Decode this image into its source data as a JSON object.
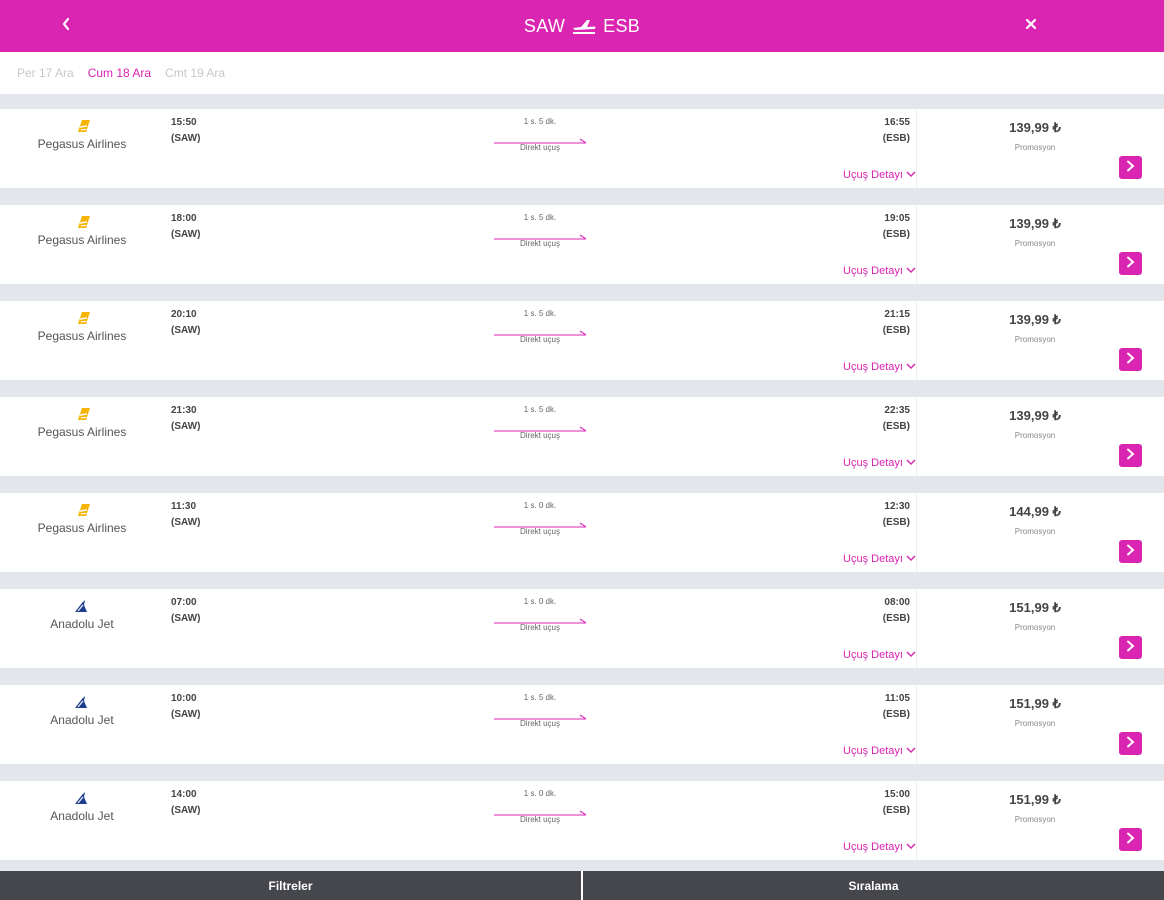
{
  "header": {
    "origin": "SAW",
    "destination": "ESB",
    "back_icon": "chevron-left-icon",
    "close_icon": "close-icon",
    "plane_icon": "plane-icon"
  },
  "date_tabs": [
    {
      "label": "Per 17 Ara",
      "active": false
    },
    {
      "label": "Cum 18 Ara",
      "active": true
    },
    {
      "label": "Cmt 19 Ara",
      "active": false
    }
  ],
  "flights": [
    {
      "airline": "Pegasus Airlines",
      "dep_time": "15:50",
      "dep_code": "(SAW)",
      "duration": "1 s. 5 dk.",
      "type": "Direkt uçuş",
      "arr_time": "16:55",
      "arr_code": "(ESB)",
      "price": "139,99 ₺",
      "fare": "Promosyon",
      "detail": "Uçuş Detayı"
    },
    {
      "airline": "Pegasus Airlines",
      "dep_time": "18:00",
      "dep_code": "(SAW)",
      "duration": "1 s. 5 dk.",
      "type": "Direkt uçuş",
      "arr_time": "19:05",
      "arr_code": "(ESB)",
      "price": "139,99 ₺",
      "fare": "Promosyon",
      "detail": "Uçuş Detayı"
    },
    {
      "airline": "Pegasus Airlines",
      "dep_time": "20:10",
      "dep_code": "(SAW)",
      "duration": "1 s. 5 dk.",
      "type": "Direkt uçuş",
      "arr_time": "21:15",
      "arr_code": "(ESB)",
      "price": "139,99 ₺",
      "fare": "Promosyon",
      "detail": "Uçuş Detayı"
    },
    {
      "airline": "Pegasus Airlines",
      "dep_time": "21:30",
      "dep_code": "(SAW)",
      "duration": "1 s. 5 dk.",
      "type": "Direkt uçuş",
      "arr_time": "22:35",
      "arr_code": "(ESB)",
      "price": "139,99 ₺",
      "fare": "Promosyon",
      "detail": "Uçuş Detayı"
    },
    {
      "airline": "Pegasus Airlines",
      "dep_time": "11:30",
      "dep_code": "(SAW)",
      "duration": "1 s. 0 dk.",
      "type": "Direkt uçuş",
      "arr_time": "12:30",
      "arr_code": "(ESB)",
      "price": "144,99 ₺",
      "fare": "Promosyon",
      "detail": "Uçuş Detayı"
    },
    {
      "airline": "Anadolu Jet",
      "dep_time": "07:00",
      "dep_code": "(SAW)",
      "duration": "1 s. 0 dk.",
      "type": "Direkt uçuş",
      "arr_time": "08:00",
      "arr_code": "(ESB)",
      "price": "151,99 ₺",
      "fare": "Promosyon",
      "detail": "Uçuş Detayı"
    },
    {
      "airline": "Anadolu Jet",
      "dep_time": "10:00",
      "dep_code": "(SAW)",
      "duration": "1 s. 5 dk.",
      "type": "Direkt uçuş",
      "arr_time": "11:05",
      "arr_code": "(ESB)",
      "price": "151,99 ₺",
      "fare": "Promosyon",
      "detail": "Uçuş Detayı"
    },
    {
      "airline": "Anadolu Jet",
      "dep_time": "14:00",
      "dep_code": "(SAW)",
      "duration": "1 s. 0 dk.",
      "type": "Direkt uçuş",
      "arr_time": "15:00",
      "arr_code": "(ESB)",
      "price": "151,99 ₺",
      "fare": "Promosyon",
      "detail": "Uçuş Detayı"
    }
  ],
  "bottom_bar": {
    "filters": "Filtreler",
    "sort": "Sıralama"
  },
  "colors": {
    "accent": "#d925b2",
    "pegasus": "#f5b400",
    "anadolujet": "#1e3c8c",
    "bottom_bar": "#46474c"
  }
}
